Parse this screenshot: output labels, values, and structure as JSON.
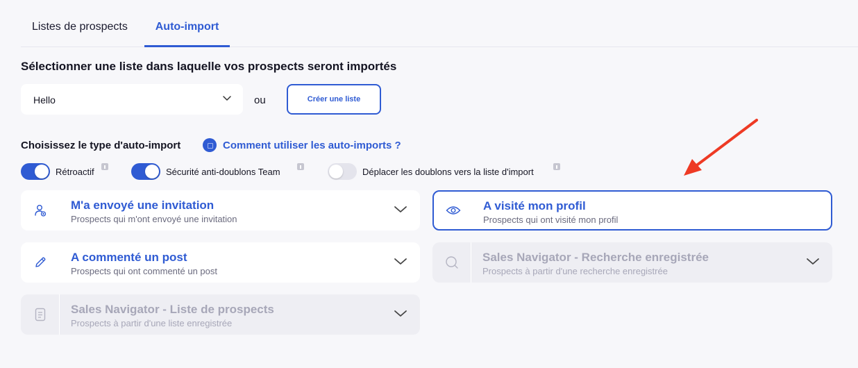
{
  "tabs": [
    {
      "label": "Listes de prospects"
    },
    {
      "label": "Auto-import"
    }
  ],
  "list_section": {
    "title": "Sélectionner une liste dans laquelle vos prospects seront importés",
    "select_value": "Hello",
    "or_text": "ou",
    "create_button": "Créer une liste"
  },
  "type_section": {
    "title": "Choisissez le type d'auto-import",
    "help_link": "Comment utiliser les auto-imports ?"
  },
  "toggles": [
    {
      "label": "Rétroactif",
      "state": "on"
    },
    {
      "label": "Sécurité anti-doublons Team",
      "state": "on"
    },
    {
      "label": "Déplacer les doublons vers la liste d'import",
      "state": "off"
    }
  ],
  "import_types": [
    {
      "title": "M'a envoyé une invitation",
      "subtitle": "Prospects qui m'ont envoyé une invitation",
      "icon": "user-add-icon",
      "state": "enabled"
    },
    {
      "title": "A visité mon profil",
      "subtitle": "Prospects qui ont visité mon profil",
      "icon": "eye-icon",
      "state": "selected"
    },
    {
      "title": "A commenté un post",
      "subtitle": "Prospects qui ont commenté un post",
      "icon": "pencil-icon",
      "state": "enabled"
    },
    {
      "title": "Sales Navigator - Recherche enregistrée",
      "subtitle": "Prospects à partir d'une recherche enregistrée",
      "icon": "search-icon",
      "state": "disabled"
    },
    {
      "title": "Sales Navigator - Liste de prospects",
      "subtitle": "Prospects à partir d'une liste enregistrée",
      "icon": "document-icon",
      "state": "disabled"
    }
  ],
  "colors": {
    "accent": "#2f5bd3",
    "annotation_arrow": "#ee3a24",
    "background": "#f7f7fa"
  }
}
